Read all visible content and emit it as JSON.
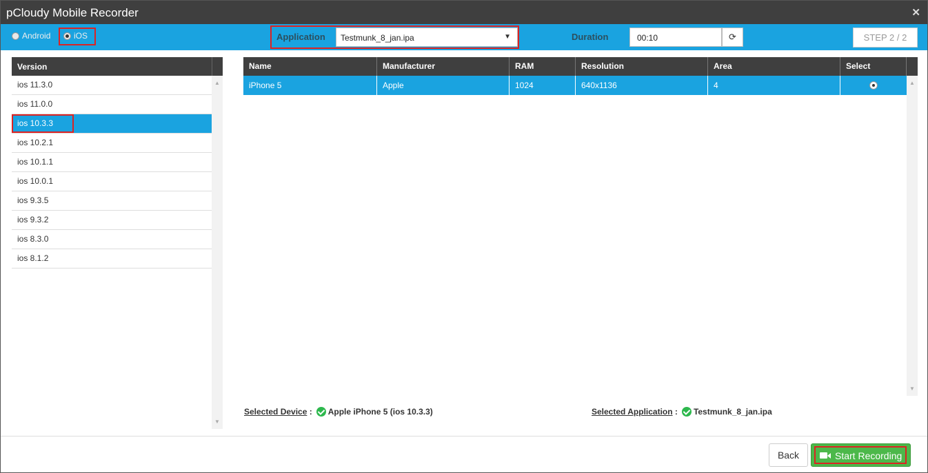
{
  "window": {
    "title": "pCloudy Mobile Recorder"
  },
  "platform": {
    "android_label": "Android",
    "ios_label": "iOS",
    "selected": "iOS"
  },
  "application": {
    "label": "Application",
    "selected_value": "Testmunk_8_jan.ipa"
  },
  "duration": {
    "label": "Duration",
    "value": "00:10"
  },
  "step": {
    "label": "STEP 2 / 2"
  },
  "versions": {
    "header": "Version",
    "items": [
      "ios 11.3.0",
      "ios 11.0.0",
      "ios 10.3.3",
      "ios 10.2.1",
      "ios 10.1.1",
      "ios 10.0.1",
      "ios 9.3.5",
      "ios 9.3.2",
      "ios 8.3.0",
      "ios 8.1.2"
    ],
    "selected": "ios 10.3.3"
  },
  "devices": {
    "columns": [
      "Name",
      "Manufacturer",
      "RAM",
      "Resolution",
      "Area",
      "Select"
    ],
    "rows": [
      {
        "name": "iPhone 5",
        "manufacturer": "Apple",
        "ram": "1024",
        "resolution": "640x1136",
        "area": "4",
        "selected": true
      }
    ]
  },
  "summary": {
    "device_key": "Selected Device",
    "device_value": "Apple iPhone 5 (ios 10.3.3)",
    "app_key": "Selected Application",
    "app_value": "Testmunk_8_jan.ipa"
  },
  "footer": {
    "back_label": "Back",
    "start_label": "Start Recording"
  },
  "colors": {
    "title_bar": "#3f3f3f",
    "accent_blue": "#1aa3e0",
    "highlight_red": "#dd2222",
    "start_green": "#4cb84a"
  }
}
